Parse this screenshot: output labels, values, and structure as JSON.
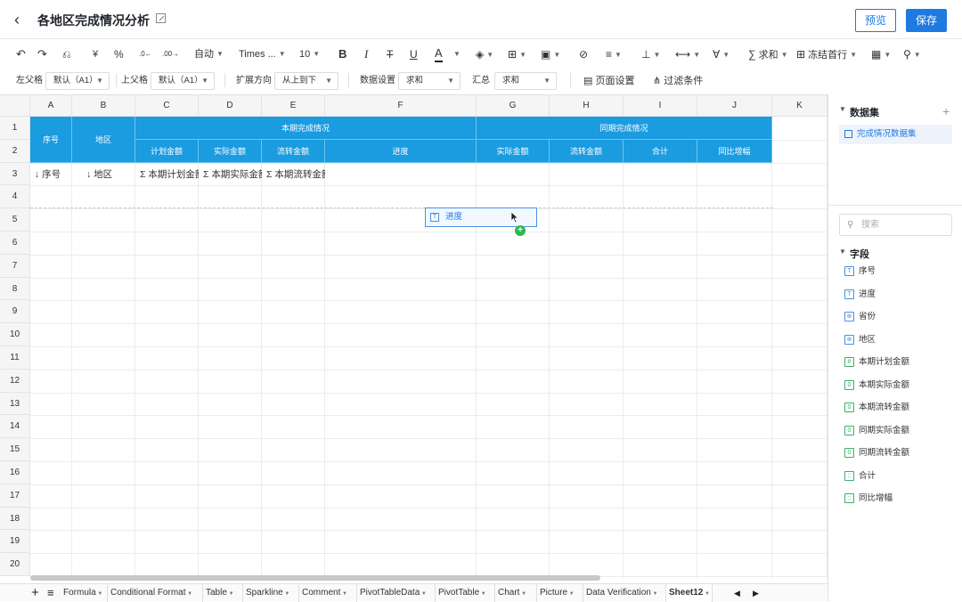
{
  "header": {
    "title": "各地区完成情况分析",
    "preview_label": "预览",
    "save_label": "保存"
  },
  "toolbar1": {
    "currency": "¥",
    "percent": "%",
    "auto": "自动",
    "font": "Times ...",
    "font_size": "10",
    "bold": "B",
    "italic": "I",
    "strike": "T",
    "underline": "U",
    "fontcolor": "A",
    "sum": "求和",
    "freeze": "冻结首行"
  },
  "toolbar2": {
    "left_parent_label": "左父格",
    "left_parent_value": "默认（A1）",
    "top_parent_label": "上父格",
    "top_parent_value": "默认（A1）",
    "expand_label": "扩展方向",
    "expand_value": "从上到下",
    "data_setting_label": "数据设置",
    "data_setting_value": "求和",
    "summary_label": "汇总",
    "summary_value": "求和",
    "page_setup": "页面设置",
    "filter": "过滤条件"
  },
  "grid": {
    "columns": [
      "A",
      "B",
      "C",
      "D",
      "E",
      "F",
      "G",
      "H",
      "I",
      "J",
      "K"
    ],
    "rows": [
      "1",
      "2",
      "3",
      "4",
      "5",
      "6",
      "7",
      "8",
      "9",
      "10",
      "11",
      "12",
      "13",
      "14",
      "15",
      "16",
      "17",
      "18",
      "19",
      "20"
    ],
    "header_cells": {
      "seq": "序号",
      "region": "地区",
      "current_group": "本期完成情况",
      "last_group": "同期完成情况",
      "plan": "计划金额",
      "actual": "实际金额",
      "flow": "流转金额",
      "progress": "进度",
      "last_actual": "实际金额",
      "last_flow": "流转金额",
      "total": "合计",
      "yoy": "同比增幅"
    },
    "row3": {
      "a": "↓ 序号",
      "b": "↓ 地区",
      "c": "Σ 本期计划金额",
      "d": "Σ 本期实际金额",
      "e": "Σ 本期流转金额"
    },
    "drag_field": "进度"
  },
  "sheet_tabs": [
    "Formula",
    "Conditional Format",
    "Table",
    "Sparkline",
    "Comment",
    "PivotTableData",
    "PivotTable",
    "Chart",
    "Picture",
    "Data Verification",
    "Sheet12"
  ],
  "active_tab": "Sheet12",
  "panel": {
    "dataset_title": "数据集",
    "dataset_item": "完成情况数据集",
    "search_placeholder": "搜索",
    "fields_title": "字段",
    "fields": [
      "序号",
      "进度",
      "省份",
      "地区",
      "本期计划金额",
      "本期实际金额",
      "本期流转金额",
      "同期实际金额",
      "同期流转金额",
      "合计",
      "同比增幅"
    ],
    "field_icons": [
      "T",
      "T",
      "⊕",
      "⊕",
      "#",
      "0",
      "0",
      "0",
      "0",
      "::",
      "::"
    ]
  },
  "colors": {
    "accent": "#1f7ae0",
    "header_blue": "#1b9be0",
    "add_green": "#2db84d"
  }
}
